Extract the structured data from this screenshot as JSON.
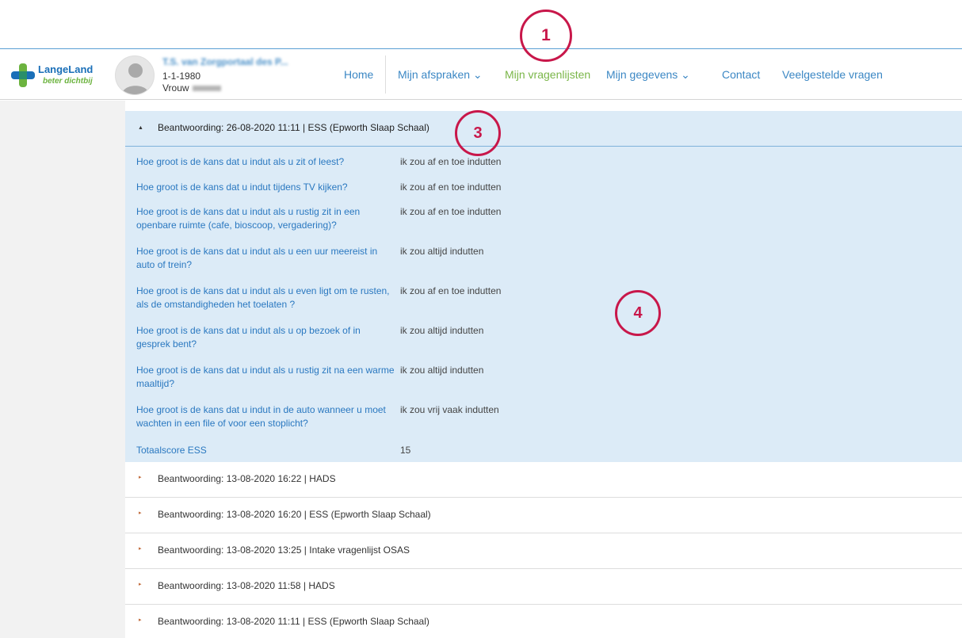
{
  "brand": {
    "name": "LangeLand",
    "tagline": "beter dichtbij"
  },
  "patient": {
    "name": "T.S. van Zorgportaal des P...",
    "dob": "1-1-1980",
    "sex": "Vrouw"
  },
  "nav": {
    "home": "Home",
    "afspraken": "Mijn afspraken ⌄",
    "vragenlijsten": "Mijn vragenlijsten",
    "gegevens": "Mijn gegevens ⌄",
    "contact": "Contact",
    "faq": "Veelgestelde vragen"
  },
  "annotations": [
    "1",
    "3",
    "4"
  ],
  "expanded": {
    "caret": "▲",
    "title": "Beantwoording: 26-08-2020 11:11 | ESS (Epworth Slaap Schaal)",
    "rows": [
      {
        "q": "Hoe groot is de kans dat u indut als u zit of leest?",
        "a": "ik zou af en toe indutten"
      },
      {
        "q": "Hoe groot is de kans dat u indut tijdens TV kijken?",
        "a": "ik zou af en toe indutten"
      },
      {
        "q": "Hoe groot is de kans dat u indut als u rustig zit in een openbare ruimte (cafe, bioscoop, vergadering)?",
        "a": "ik zou af en toe indutten"
      },
      {
        "q": "Hoe groot is de kans dat u indut als u een uur meereist in auto of trein?",
        "a": "ik zou altijd indutten"
      },
      {
        "q": "Hoe groot is de kans dat u indut als u even ligt om te rusten, als de omstandigheden het toelaten ?",
        "a": "ik zou af en toe indutten"
      },
      {
        "q": "Hoe groot is de kans dat u indut als u op bezoek of in gesprek bent?",
        "a": "ik zou altijd indutten"
      },
      {
        "q": "Hoe groot is de kans dat u indut als u rustig zit na een warme maaltijd?",
        "a": "ik zou altijd indutten"
      },
      {
        "q": "Hoe groot is de kans dat u indut in de auto wanneer u moet wachten in een file of voor een stoplicht?",
        "a": "ik zou vrij vaak indutten"
      },
      {
        "q": "Totaalscore ESS",
        "a": "15"
      }
    ]
  },
  "collapsed": {
    "caret": "▸",
    "items": [
      "Beantwoording: 13-08-2020 16:22 | HADS",
      "Beantwoording: 13-08-2020 16:20 | ESS (Epworth Slaap Schaal)",
      "Beantwoording: 13-08-2020 13:25 | Intake vragenlijst OSAS",
      "Beantwoording: 13-08-2020 11:58 | HADS",
      "Beantwoording: 13-08-2020 11:11 | ESS (Epworth Slaap Schaal)"
    ]
  },
  "colors": {
    "nav_link": "#3b87c4",
    "nav_active": "#7ab648",
    "question": "#2a78c0",
    "expanded_bg": "#dcebf7",
    "annotation": "#c8174a"
  }
}
